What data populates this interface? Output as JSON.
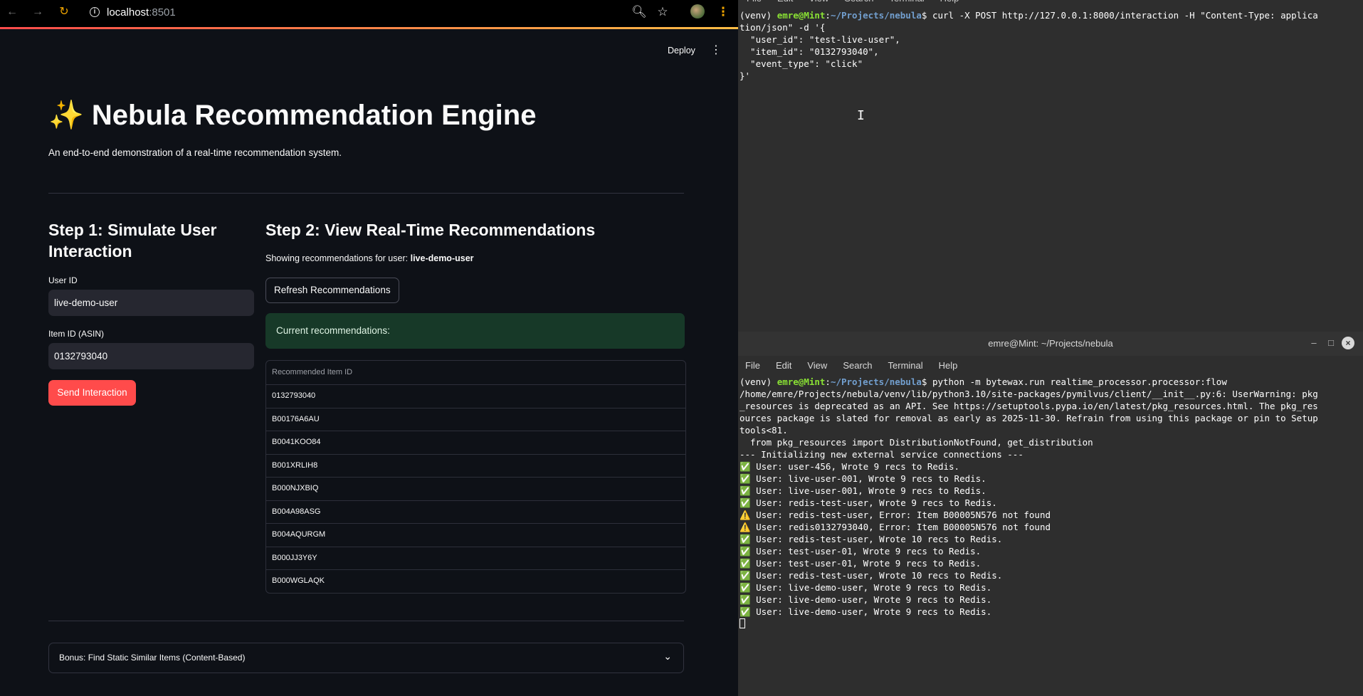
{
  "browser": {
    "url_host": "localhost",
    "url_port": ":8501",
    "deploy_label": "Deploy"
  },
  "app": {
    "title": "✨ Nebula Recommendation Engine",
    "subtitle": "An end-to-end demonstration of a real-time recommendation system.",
    "step1": {
      "heading": "Step 1: Simulate User Interaction",
      "user_id_label": "User ID",
      "user_id_value": "live-demo-user",
      "item_id_label": "Item ID (ASIN)",
      "item_id_value": "0132793040",
      "send_button": "Send Interaction"
    },
    "step2": {
      "heading": "Step 2: View Real-Time Recommendations",
      "showing_prefix": "Showing recommendations for user:",
      "showing_user": "live-demo-user",
      "refresh_button": "Refresh Recommendations",
      "alert_text": "Current recommendations:",
      "table_header": "Recommended Item ID",
      "items": [
        "0132793040",
        "B00176A6AU",
        "B0041KOO84",
        "B001XRLIH8",
        "B000NJXBIQ",
        "B004A98ASG",
        "B004AQURGM",
        "B000JJ3Y6Y",
        "B000WGLAQK"
      ]
    },
    "bonus_label": "Bonus: Find Static Similar Items (Content-Based)"
  },
  "terminal1": {
    "menu": [
      "File",
      "Edit",
      "View",
      "Search",
      "Terminal",
      "Help"
    ],
    "prompt_env": "(venv) ",
    "prompt_user": "emre@Mint",
    "prompt_colon": ":",
    "prompt_path": "~/Projects/nebula",
    "command_line1": "$ curl -X POST http://127.0.0.1:8000/interaction -H \"Content-Type: applica",
    "lines": [
      "tion/json\" -d '{",
      "  \"user_id\": \"test-live-user\",",
      "  \"item_id\": \"0132793040\",",
      "  \"event_type\": \"click\"",
      "}'"
    ]
  },
  "terminal2": {
    "title": "emre@Mint: ~/Projects/nebula",
    "menu": [
      "File",
      "Edit",
      "View",
      "Search",
      "Terminal",
      "Help"
    ],
    "prompt_env": "(venv) ",
    "prompt_user": "emre@Mint",
    "prompt_colon": ":",
    "prompt_path": "~/Projects/nebula",
    "command": "$ python -m bytewax.run realtime_processor.processor:flow",
    "lines": [
      "/home/emre/Projects/nebula/venv/lib/python3.10/site-packages/pymilvus/client/__init__.py:6: UserWarning: pkg",
      "_resources is deprecated as an API. See https://setuptools.pypa.io/en/latest/pkg_resources.html. The pkg_res",
      "ources package is slated for removal as early as 2025-11-30. Refrain from using this package or pin to Setup",
      "tools<81.",
      "  from pkg_resources import DistributionNotFound, get_distribution",
      "--- Initializing new external service connections ---",
      "✅ User: user-456, Wrote 9 recs to Redis.",
      "✅ User: live-user-001, Wrote 9 recs to Redis.",
      "✅ User: live-user-001, Wrote 9 recs to Redis.",
      "✅ User: redis-test-user, Wrote 9 recs to Redis.",
      "⚠️ User: redis-test-user, Error: Item B00005N576 not found",
      "⚠️ User: redis0132793040, Error: Item B00005N576 not found",
      "✅ User: redis-test-user, Wrote 10 recs to Redis.",
      "✅ User: test-user-01, Wrote 9 recs to Redis.",
      "✅ User: test-user-01, Wrote 9 recs to Redis.",
      "✅ User: redis-test-user, Wrote 10 recs to Redis.",
      "✅ User: live-demo-user, Wrote 9 recs to Redis.",
      "✅ User: live-demo-user, Wrote 9 recs to Redis.",
      "✅ User: live-demo-user, Wrote 9 recs to Redis."
    ]
  }
}
